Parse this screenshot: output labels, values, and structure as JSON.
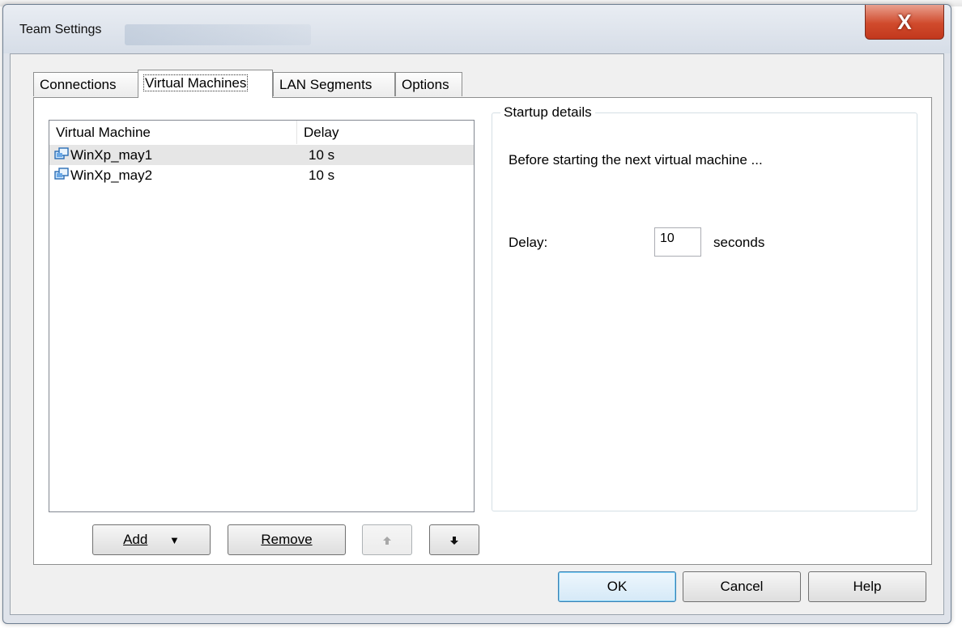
{
  "window": {
    "title": "Team Settings",
    "close_glyph": "X"
  },
  "tabs": [
    {
      "label": "Connections",
      "active": false
    },
    {
      "label": "Virtual Machines",
      "active": true
    },
    {
      "label": "LAN Segments",
      "active": false
    },
    {
      "label": "Options",
      "active": false
    }
  ],
  "vm_list": {
    "columns": [
      "Virtual Machine",
      "Delay"
    ],
    "rows": [
      {
        "name": "WinXp_may1",
        "delay": "10 s",
        "selected": true,
        "icon": "vm-icon"
      },
      {
        "name": "WinXp_may2",
        "delay": "10 s",
        "selected": false,
        "icon": "vm-icon"
      }
    ]
  },
  "list_buttons": {
    "add_label": "Add",
    "add_arrow": "▼",
    "remove_label": "Remove",
    "up_icon": "arrow-up-icon",
    "down_icon": "arrow-down-icon"
  },
  "startup": {
    "title": "Startup details",
    "description": "Before starting the next virtual machine ...",
    "delay_label": "Delay:",
    "delay_value": "10",
    "unit_label": "seconds"
  },
  "footer": {
    "ok_label": "OK",
    "cancel_label": "Cancel",
    "help_label": "Help"
  },
  "colors": {
    "accent": "#3c7fb1",
    "close": "#c2381d",
    "selection": "#e6e6e6"
  }
}
